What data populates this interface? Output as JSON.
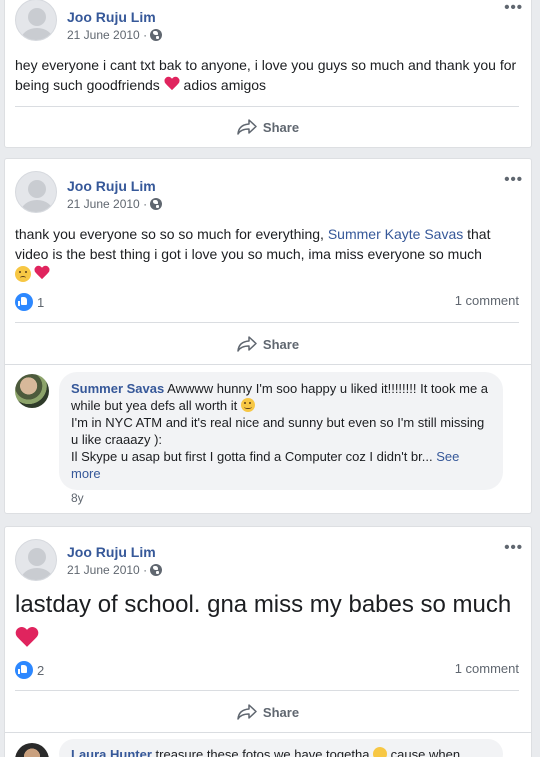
{
  "posts": [
    {
      "author": "Joo Ruju Lim",
      "date": "21 June 2010 ·",
      "text": "hey everyone i cant txt bak to anyone, i love you guys so much and thank you for being such goodfriends",
      "text_after_heart": " adios amigos",
      "share_label": "Share"
    },
    {
      "author": "Joo Ruju Lim",
      "date": "21 June 2010 ·",
      "text_before_link": "thank you everyone so so so much for everything, ",
      "link_text": "Summer Kayte Savas",
      "text_after_link": " that video is the best thing i got i love you so much, ima miss everyone so much",
      "likes": "1",
      "comments": "1 comment",
      "share_label": "Share",
      "comment": {
        "author": "Summer Savas",
        "line1": " Awwww hunny I'm soo happy u liked it!!!!!!!! It took me a while but yea defs all worth it ",
        "line2": "I'm in NYC ATM and it's real nice and sunny but even so I'm still missing u like craaazy ):",
        "line3": "Il Skype u asap but first I gotta find a Computer coz I didn't br...",
        "see_more": " See more",
        "time": "8y"
      }
    },
    {
      "author": "Joo Ruju Lim",
      "date": "21 June 2010 ·",
      "text": "lastday of school. gna miss my babes so much",
      "likes": "2",
      "comments": "1 comment",
      "share_label": "Share",
      "partial_comment": {
        "author": "Laura Hunter",
        "text": " treasure these fotos we have togetha",
        "text_after": " cause when"
      }
    }
  ],
  "more_icon": "•••",
  "colors": {
    "link": "#365899",
    "like": "#2d88ff",
    "heart": "#e0245e",
    "background": "#e9ebee"
  }
}
